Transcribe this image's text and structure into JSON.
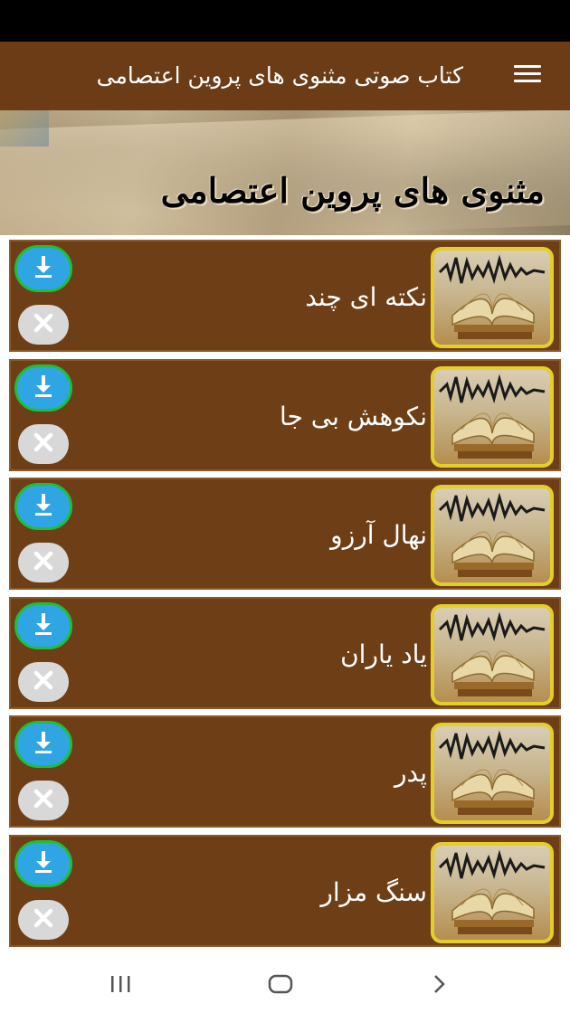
{
  "app_bar": {
    "title": "کتاب صوتی مثنوی های پروین اعتصامی",
    "menu_icon": "hamburger-menu-icon"
  },
  "banner": {
    "title": "مثنوی های پروین اعتصامی"
  },
  "items": [
    {
      "title": "نکته ای چند"
    },
    {
      "title": "نکوهش بی جا"
    },
    {
      "title": "نهال آرزو"
    },
    {
      "title": "یاد یاران"
    },
    {
      "title": "پدر"
    },
    {
      "title": "سنگ مزار"
    }
  ],
  "item_icons": {
    "thumbnail": "book-soundwave-image",
    "download": "download-icon",
    "delete": "close-icon"
  },
  "nav_bar": {
    "recent": "recent-apps-icon",
    "home": "home-icon",
    "back": "back-icon"
  },
  "colors": {
    "app_bar": "#6b3c16",
    "item_background": "#6e3f16",
    "download_button": "#2fa6e3",
    "download_ring": "#1fbf3a",
    "thumb_border": "#e4cf2a"
  }
}
